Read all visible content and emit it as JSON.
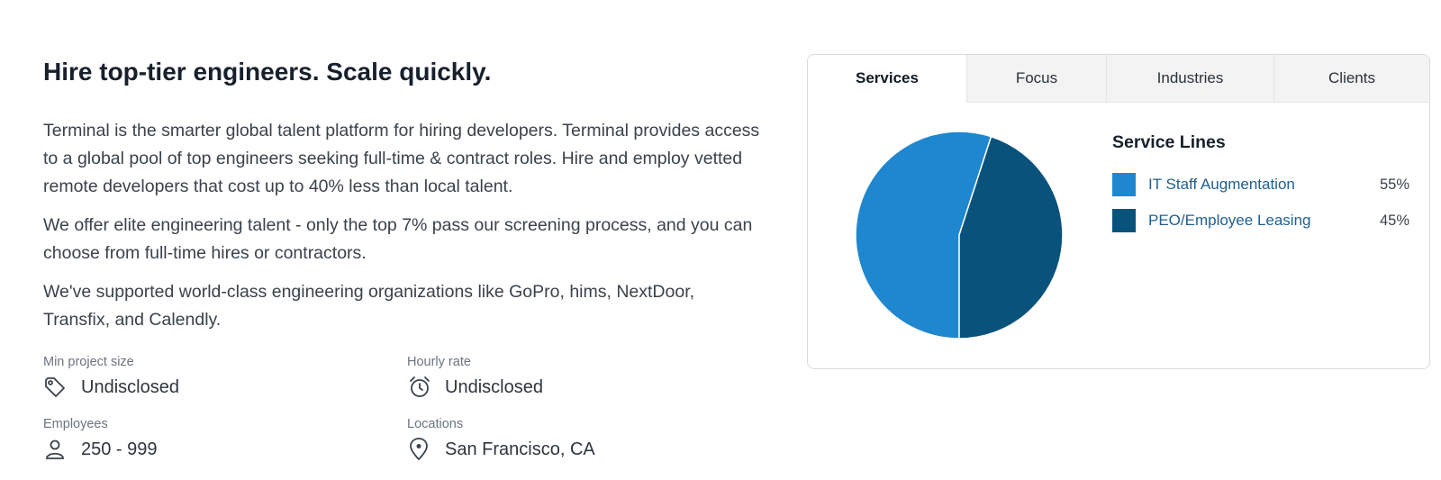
{
  "headline": "Hire top-tier engineers. Scale quickly.",
  "paragraphs": [
    "Terminal is the smarter global talent platform for hiring developers.  Terminal provides access to a global pool of top engineers seeking full-time & contract roles. Hire and employ vetted remote developers that cost up to 40% less than local talent.",
    "We offer elite engineering talent - only the top 7% pass our screening process, and you can choose from full-time hires or contractors.",
    "We've supported world-class engineering organizations like GoPro, hims, NextDoor, Transfix, and Calendly."
  ],
  "facts": {
    "min_project": {
      "label": "Min project size",
      "value": "Undisclosed",
      "icon": "price-tag-icon"
    },
    "hourly_rate": {
      "label": "Hourly rate",
      "value": "Undisclosed",
      "icon": "alarm-clock-icon"
    },
    "employees": {
      "label": "Employees",
      "value": "250 - 999",
      "icon": "person-icon"
    },
    "locations": {
      "label": "Locations",
      "value": "San Francisco, CA",
      "icon": "location-pin-icon"
    }
  },
  "tabs": [
    {
      "label": "Services",
      "active": true
    },
    {
      "label": "Focus",
      "active": false
    },
    {
      "label": "Industries",
      "active": false
    },
    {
      "label": "Clients",
      "active": false
    }
  ],
  "service_lines": {
    "title": "Service Lines",
    "items": [
      {
        "label": "IT Staff Augmentation",
        "percent": "55%",
        "value": 55,
        "color": "#1e87cf"
      },
      {
        "label": "PEO/Employee Leasing",
        "percent": "45%",
        "value": 45,
        "color": "#08527c"
      }
    ]
  },
  "chart_data": {
    "type": "pie",
    "title": "Service Lines",
    "categories": [
      "IT Staff Augmentation",
      "PEO/Employee Leasing"
    ],
    "values": [
      55,
      45
    ],
    "colors": [
      "#1e87cf",
      "#08527c"
    ]
  }
}
